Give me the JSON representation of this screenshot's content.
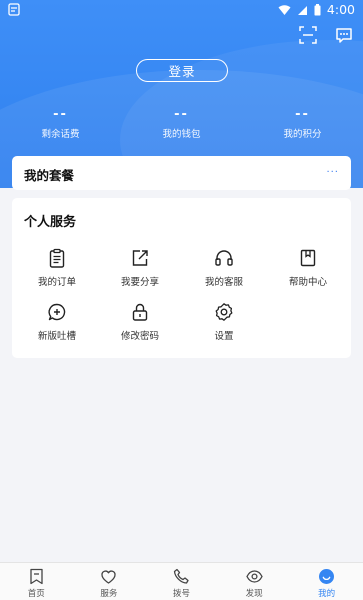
{
  "status_bar": {
    "time": "4:00"
  },
  "header": {
    "login_label": "登录"
  },
  "stats": [
    {
      "value": "--",
      "label": "剩余话费"
    },
    {
      "value": "--",
      "label": "我的钱包"
    },
    {
      "value": "--",
      "label": "我的积分"
    }
  ],
  "package": {
    "title": "我的套餐",
    "more": "..."
  },
  "services": {
    "title": "个人服务",
    "items": [
      {
        "label": "我的订单",
        "icon": "clipboard-icon"
      },
      {
        "label": "我要分享",
        "icon": "share-icon"
      },
      {
        "label": "我的客服",
        "icon": "headset-icon"
      },
      {
        "label": "帮助中心",
        "icon": "book-icon"
      },
      {
        "label": "新版吐槽",
        "icon": "feedback-icon"
      },
      {
        "label": "修改密码",
        "icon": "lock-icon"
      },
      {
        "label": "设置",
        "icon": "gear-icon"
      }
    ]
  },
  "tabs": [
    {
      "label": "首页",
      "icon": "bookmark-icon"
    },
    {
      "label": "服务",
      "icon": "heart-icon"
    },
    {
      "label": "拨号",
      "icon": "phone-icon"
    },
    {
      "label": "发现",
      "icon": "eye-icon"
    },
    {
      "label": "我的",
      "icon": "smile-icon",
      "active": true
    }
  ],
  "colors": {
    "primary": "#3586f2",
    "background": "#f3f4f8"
  }
}
